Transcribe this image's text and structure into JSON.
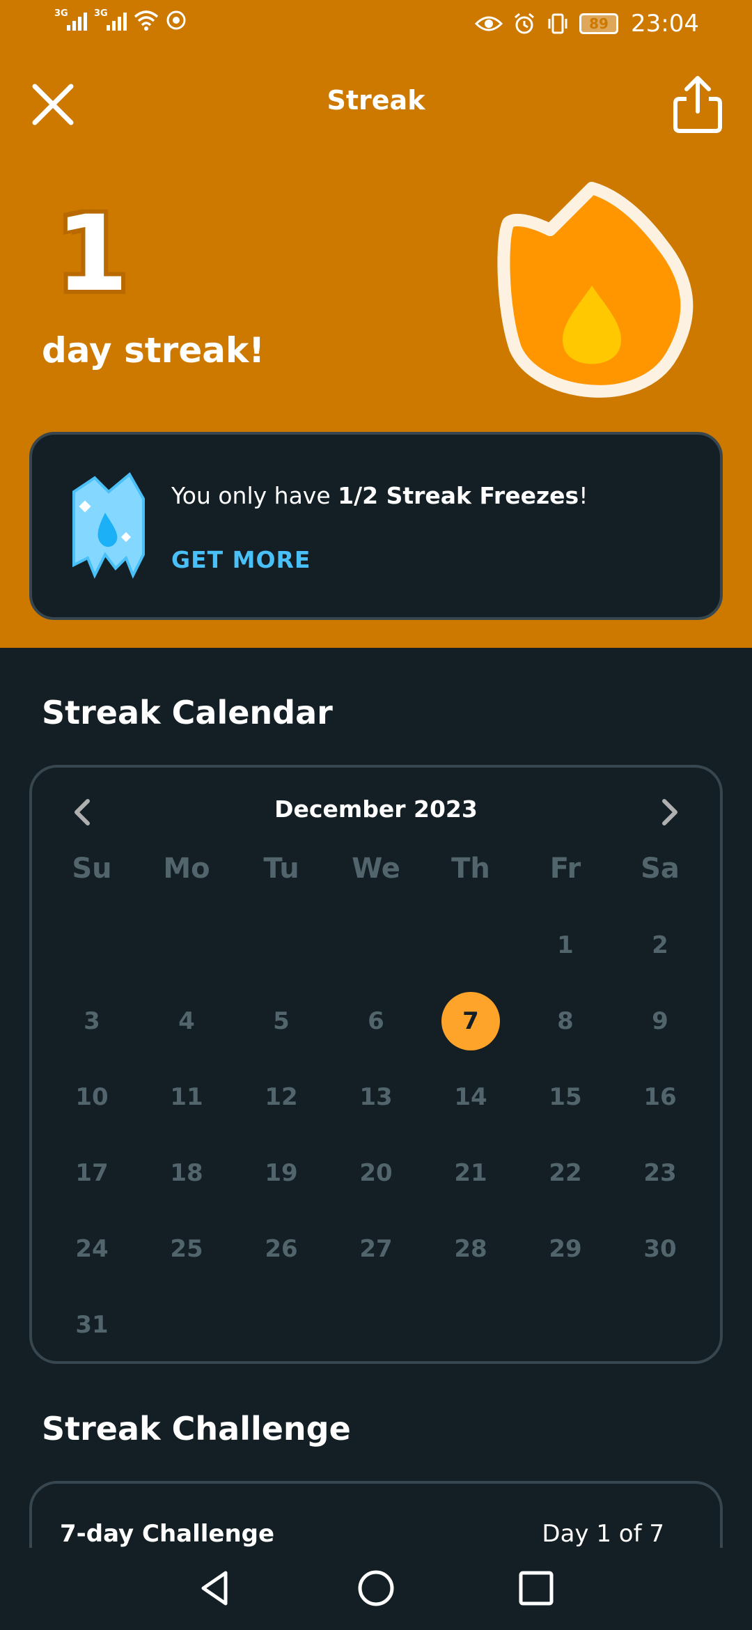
{
  "status_bar": {
    "sim1_label": "3G",
    "sim2_label": "3G",
    "battery_level": "89",
    "time": "23:04"
  },
  "header": {
    "title": "Streak"
  },
  "streak": {
    "count": "1",
    "label": "day streak!"
  },
  "freeze": {
    "text_prefix": "You only have ",
    "text_bold": "1/2 Streak Freezes",
    "text_suffix": "!",
    "cta": "GET MORE"
  },
  "calendar": {
    "section_title": "Streak Calendar",
    "month": "December 2023",
    "weekdays": [
      "Su",
      "Mo",
      "Tu",
      "We",
      "Th",
      "Fr",
      "Sa"
    ],
    "leading_blanks": 5,
    "days_in_month": 31,
    "today": 7
  },
  "challenge": {
    "section_title": "Streak Challenge",
    "name": "7-day Challenge",
    "progress": "Day 1 of 7"
  },
  "colors": {
    "hero_bg": "#cd7900",
    "page_bg": "#131f24",
    "card_border": "#37464f",
    "accent_blue": "#49c0f8",
    "today_circle": "#ffa42a",
    "muted_text": "#52656d"
  }
}
